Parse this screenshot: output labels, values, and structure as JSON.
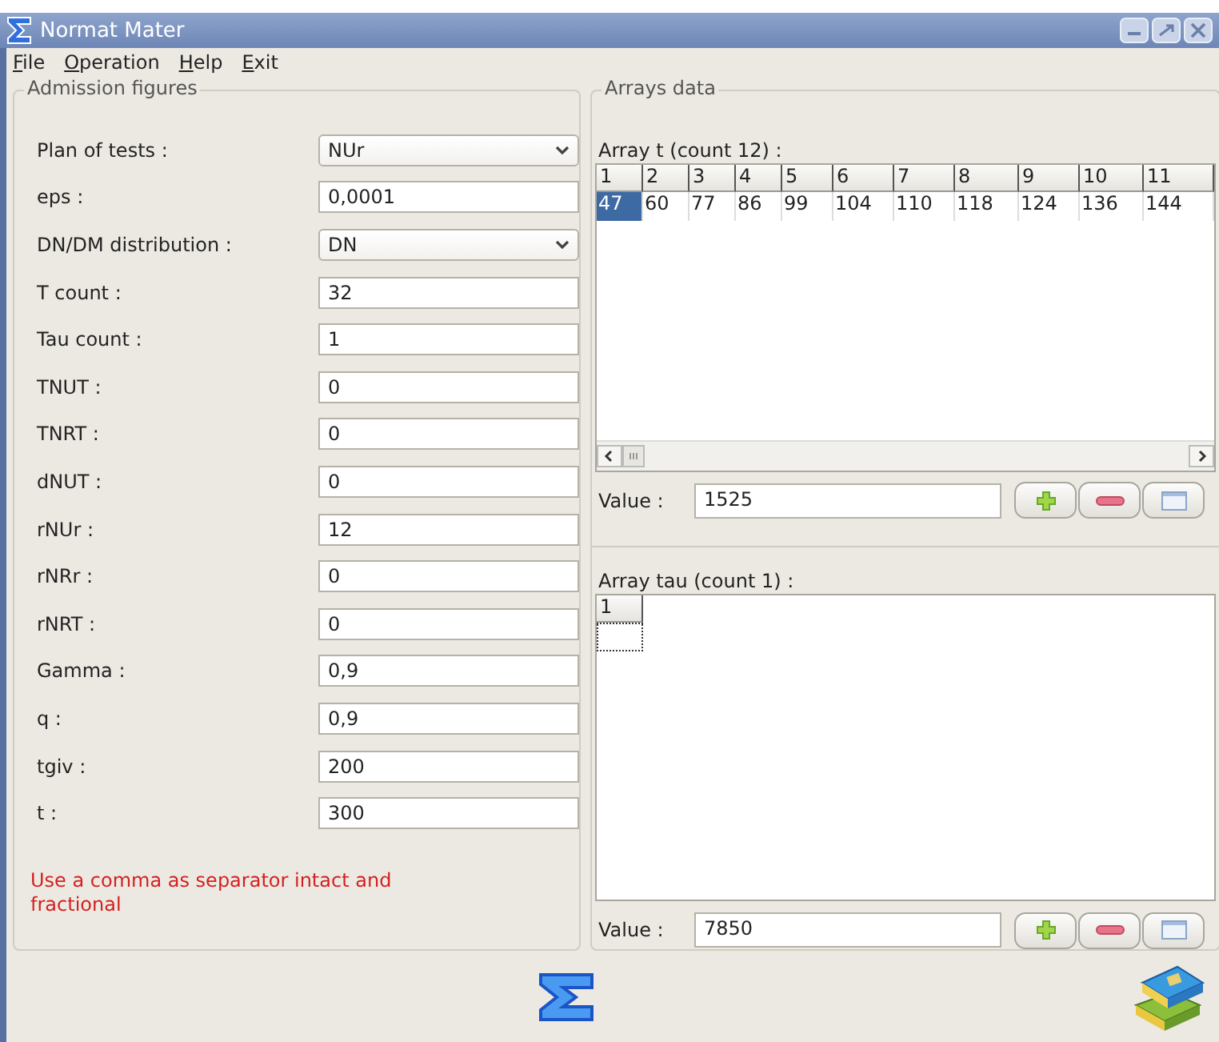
{
  "window": {
    "title": "Normat Mater"
  },
  "menu": [
    {
      "label": "File"
    },
    {
      "label": "Operation"
    },
    {
      "label": "Help"
    },
    {
      "label": "Exit"
    }
  ],
  "admission": {
    "title": "Admission figures",
    "fields": [
      {
        "label": "Plan of tests :",
        "kind": "combo",
        "value": "NUr"
      },
      {
        "label": "eps :",
        "kind": "text",
        "value": "0,0001"
      },
      {
        "label": "DN/DM distribution :",
        "kind": "combo",
        "value": "DN"
      },
      {
        "label": "T count :",
        "kind": "text",
        "value": "32"
      },
      {
        "label": "Tau count :",
        "kind": "text",
        "value": "1"
      },
      {
        "label": "TNUT :",
        "kind": "text",
        "value": "0"
      },
      {
        "label": "TNRT :",
        "kind": "text",
        "value": "0"
      },
      {
        "label": "dNUT :",
        "kind": "text",
        "value": "0"
      },
      {
        "label": "rNUr :",
        "kind": "text",
        "value": "12"
      },
      {
        "label": "rNRr :",
        "kind": "text",
        "value": "0"
      },
      {
        "label": "rNRT :",
        "kind": "text",
        "value": "0"
      },
      {
        "label": "Gamma :",
        "kind": "text",
        "value": "0,9"
      },
      {
        "label": "q :",
        "kind": "text",
        "value": "0,9"
      },
      {
        "label": "tgiv :",
        "kind": "text",
        "value": "200"
      },
      {
        "label": "t :",
        "kind": "text",
        "value": "300"
      }
    ],
    "note": "Use a comma as separator intact and fractional"
  },
  "arrays": {
    "title": "Arrays data",
    "items": [
      {
        "title": "Array t (count 12) :",
        "columns": [
          "1",
          "2",
          "3",
          "4",
          "5",
          "6",
          "7",
          "8",
          "9",
          "10",
          "11"
        ],
        "cells": [
          {
            "text": "47",
            "selected": true,
            "focused": false
          },
          {
            "text": "60",
            "selected": false,
            "focused": false
          },
          {
            "text": "77",
            "selected": false,
            "focused": false
          },
          {
            "text": "86",
            "selected": false,
            "focused": false
          },
          {
            "text": "99",
            "selected": false,
            "focused": false
          },
          {
            "text": "104",
            "selected": false,
            "focused": false
          },
          {
            "text": "110",
            "selected": false,
            "focused": false
          },
          {
            "text": "118",
            "selected": false,
            "focused": false
          },
          {
            "text": "124",
            "selected": false,
            "focused": false
          },
          {
            "text": "136",
            "selected": false,
            "focused": false
          },
          {
            "text": "144",
            "selected": false,
            "focused": false
          }
        ],
        "scrollbar": true,
        "value_label": "Value :",
        "value": "1525"
      },
      {
        "title": "Array tau (count 1) :",
        "columns": [
          "1"
        ],
        "cells": [
          {
            "selected": false,
            "focused": true
          }
        ],
        "scrollbar": false,
        "value_label": "Value :",
        "value": "7850"
      }
    ]
  }
}
